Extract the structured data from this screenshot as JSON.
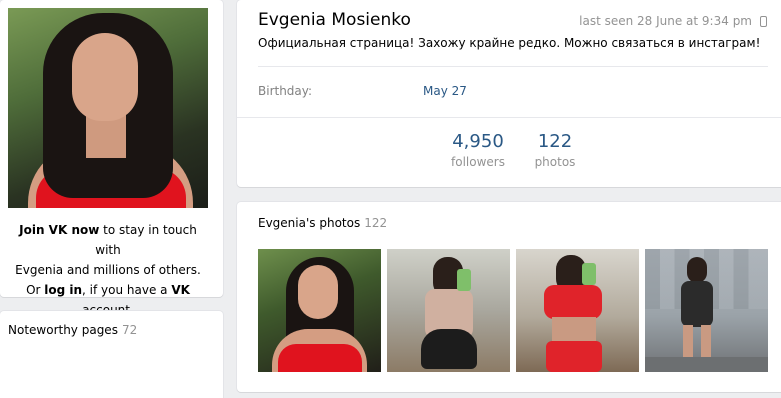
{
  "profile": {
    "name": "Evgenia Mosienko",
    "last_seen": "last seen 28 June at 9:34 pm",
    "status": "Официальная страница! Захожу крайне редко. Можно связаться в инстаграм!",
    "birthday_label": "Birthday:",
    "birthday_value": "May 27"
  },
  "counters": [
    {
      "value": "4,950",
      "label": "followers"
    },
    {
      "value": "122",
      "label": "photos"
    }
  ],
  "join": {
    "line1_bold": "Join VK now",
    "line1_rest": " to stay in touch with",
    "line2": "Evgenia and millions of others.",
    "line3_pre": "Or ",
    "line3_bold1": "log in",
    "line3_mid": ", if you have a ",
    "line3_bold2": "VK",
    "line3_post": " account."
  },
  "noteworthy": {
    "title": "Noteworthy pages",
    "count": "72"
  },
  "photos": {
    "title": "Evgenia's photos",
    "count": "122"
  },
  "icons": {
    "device": "mobile-phone-icon"
  },
  "colors": {
    "link": "#2a5885",
    "muted": "#939393",
    "background": "#edeef0"
  }
}
